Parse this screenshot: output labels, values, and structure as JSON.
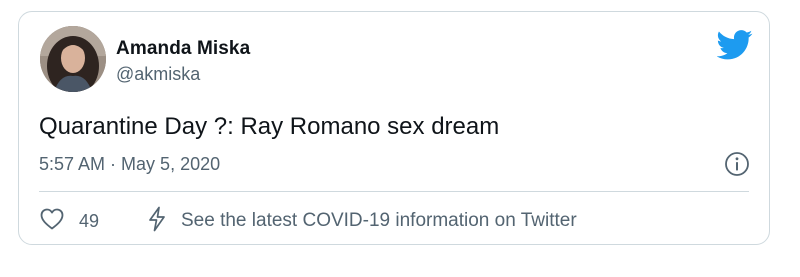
{
  "author": {
    "name": "Amanda Miska",
    "handle": "@akmiska"
  },
  "tweet": {
    "text": "Quarantine Day ?: Ray Romano sex dream",
    "time": "5:57 AM",
    "separator": "·",
    "date": "May 5, 2020"
  },
  "actions": {
    "like_count": "49",
    "covid_info": "See the latest COVID-19 information on Twitter"
  },
  "icons": {
    "brand": "twitter-bird-icon",
    "info": "info-icon",
    "like": "heart-icon",
    "covid": "lightning-icon"
  },
  "colors": {
    "twitter_blue": "#1d9bf0",
    "secondary_text": "#536471",
    "primary_text": "#0f1419",
    "border": "#cfd9de"
  }
}
